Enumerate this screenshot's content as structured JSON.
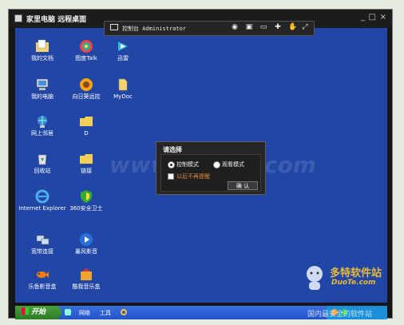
{
  "window": {
    "title": "家里电脑 远程桌面",
    "min": "_",
    "max": "□",
    "close": "×"
  },
  "toolbar": {
    "label": "控制台 Administrator"
  },
  "desktop": {
    "icons": [
      {
        "label": "我的文档",
        "icon": "folder-docs-icon"
      },
      {
        "label": "图度Talk",
        "icon": "talk-icon"
      },
      {
        "label": "迅雷",
        "icon": "thunder-icon"
      },
      {
        "label": "我的电脑",
        "icon": "computer-icon"
      },
      {
        "label": "向日葵远控",
        "icon": "sunflower-icon"
      },
      {
        "label": "MyDoc",
        "icon": "doc-icon"
      },
      {
        "label": "网上邻居",
        "icon": "network-icon"
      },
      {
        "label": "D",
        "icon": "folder-icon"
      },
      {
        "label": "回收站",
        "icon": "recycle-bin-icon"
      },
      {
        "label": "链接",
        "icon": "folder-icon"
      },
      {
        "label": "Internet Explorer",
        "icon": "ie-icon"
      },
      {
        "label": "360安全卫士",
        "icon": "shield-icon"
      },
      {
        "label": "宽带连接",
        "icon": "broadband-icon"
      },
      {
        "label": "暴风影音",
        "icon": "media-player-icon"
      },
      {
        "label": "乐鱼影音盒",
        "icon": "fish-icon"
      },
      {
        "label": "酷我音乐盒",
        "icon": "music-icon"
      }
    ]
  },
  "dialog": {
    "title": "请选择",
    "option_control": "控制模式",
    "option_view": "观看模式",
    "checkbox_label": "以后不再提醒",
    "ok_button": "确 认"
  },
  "taskbar": {
    "start_label": "开始",
    "items": [
      "网络",
      "工具"
    ]
  },
  "watermarks": {
    "center": "www.DuoTe.com",
    "brand": "多特软件站",
    "brand_url": "DuoTe.com",
    "bottom": "国内最安全的软件站"
  }
}
